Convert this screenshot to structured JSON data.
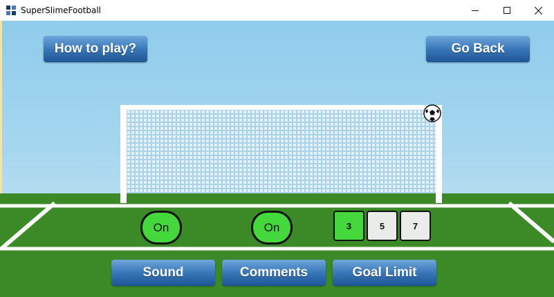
{
  "window": {
    "title": "SuperSlimeFootball"
  },
  "menu": {
    "how_to_play": "How to play?",
    "go_back": "Go Back"
  },
  "settings": {
    "sound": {
      "label": "Sound",
      "state": "On"
    },
    "comments": {
      "label": "Comments",
      "state": "On"
    },
    "goal_limit": {
      "label": "Goal Limit",
      "options": [
        "3",
        "5",
        "7"
      ],
      "selected": "3"
    }
  },
  "colors": {
    "toggle_on": "#45d83c",
    "button_blue": "#3877b9",
    "grass": "#3c8a27",
    "sky": "#a5d6ef"
  },
  "icons": {
    "app": "app-logo-icon",
    "ball": "soccer-ball-icon"
  }
}
